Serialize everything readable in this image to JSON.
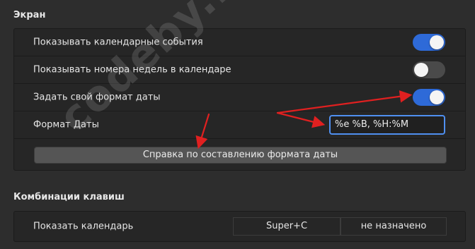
{
  "sections": {
    "screen": {
      "title": "Экран",
      "rows": [
        {
          "label": "Показывать календарные события",
          "switch_on": true
        },
        {
          "label": "Показывать номера недель в календаре",
          "switch_on": false
        },
        {
          "label": "Задать свой формат даты",
          "switch_on": true
        },
        {
          "label": "Формат Даты",
          "input_value": "%e %B, %H:%M"
        }
      ],
      "help_button": "Справка по составлению формата даты"
    },
    "keys": {
      "title": "Комбинации клавиш",
      "rows": [
        {
          "label": "Показать календарь",
          "primary": "Super+C",
          "secondary": "не назначено"
        }
      ]
    }
  },
  "watermark": "codeby.net",
  "colors": {
    "switch_on": "#2e6ad8",
    "switch_off": "#4a4a4a",
    "input_focus": "#4f8ff0",
    "annotation_arrow": "#e02020"
  }
}
